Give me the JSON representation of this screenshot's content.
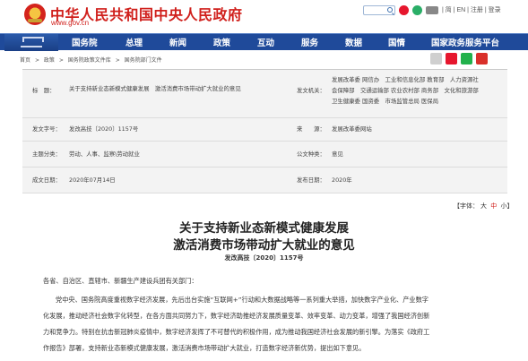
{
  "header": {
    "site_title": "中华人民共和国中央人民政府",
    "site_url": "www.gov.cn",
    "language_links": "| 简 | EN | 注册 | 登录"
  },
  "nav": {
    "items": [
      "国务院",
      "总理",
      "新闻",
      "政策",
      "互动",
      "服务",
      "数据",
      "国情",
      "国家政务服务平台"
    ]
  },
  "breadcrumb": [
    "首页",
    ">",
    "政策",
    ">",
    "国务院政策文件库",
    ">",
    "国务院部门文件"
  ],
  "info": {
    "title_label": "标　题：",
    "title_value": "关于支持新业态新模式健康发展　激活消费市场带动扩大就业的意见",
    "issuer_label": "发文机关：",
    "issuer_lines": [
      "发展改革委 网信办　工业和信息化部 教育部　人力资源社",
      "会保障部　交通运输部 农业农村部 商务部　文化和旅游部",
      "卫生健康委 国资委　市场监管总局 医保局"
    ],
    "docno_label": "发文字号：",
    "docno_value": "发改高技〔2020〕1157号",
    "source_label": "来　　源：",
    "source_value": "发展改革委网站",
    "category_label": "主题分类：",
    "category_value": "劳动、人事、监察\\劳动就业",
    "doctype_label": "公文种类：",
    "doctype_value": "意见",
    "date_label": "成文日期：",
    "date_value": "2020年07月14日",
    "pubdate_label": "发布日期：",
    "pubdate_value": "2020年"
  },
  "font_size": {
    "label": "【字体：",
    "large": "大",
    "medium": "中",
    "small": "小】"
  },
  "article": {
    "title_line1": "关于支持新业态新模式健康发展",
    "title_line2": "激活消费市场带动扩大就业的意见",
    "doc_number": "发改高技〔2020〕1157号",
    "salutation": "各省、自治区、直辖市、新疆生产建设兵团有关部门：",
    "paragraph_lines": [
      "党中央、国务院高度重视数字经济发展，先后出台实施“互联网+”行动和大数据战略等一系列重大举措，加快数字产业化、产业数字",
      "化发展，推动经济社会数字化转型，在各方面共同努力下，数字经济助推经济发展质量变革、效率变革、动力变革，增强了我国经济创新",
      "力和竞争力。特别在抗击新冠肺炎疫情中，数字经济发挥了不可替代的积极作用，成为推动我国经济社会发展的新引擎。为落实《政府工",
      "作报告》部署，支持新业态新模式健康发展，激活消费市场带动扩大就业，打造数字经济新优势，提出如下意见。"
    ]
  },
  "colors": {
    "brand_red": "#d0201c",
    "nav_blue": "#1f4a9a"
  }
}
